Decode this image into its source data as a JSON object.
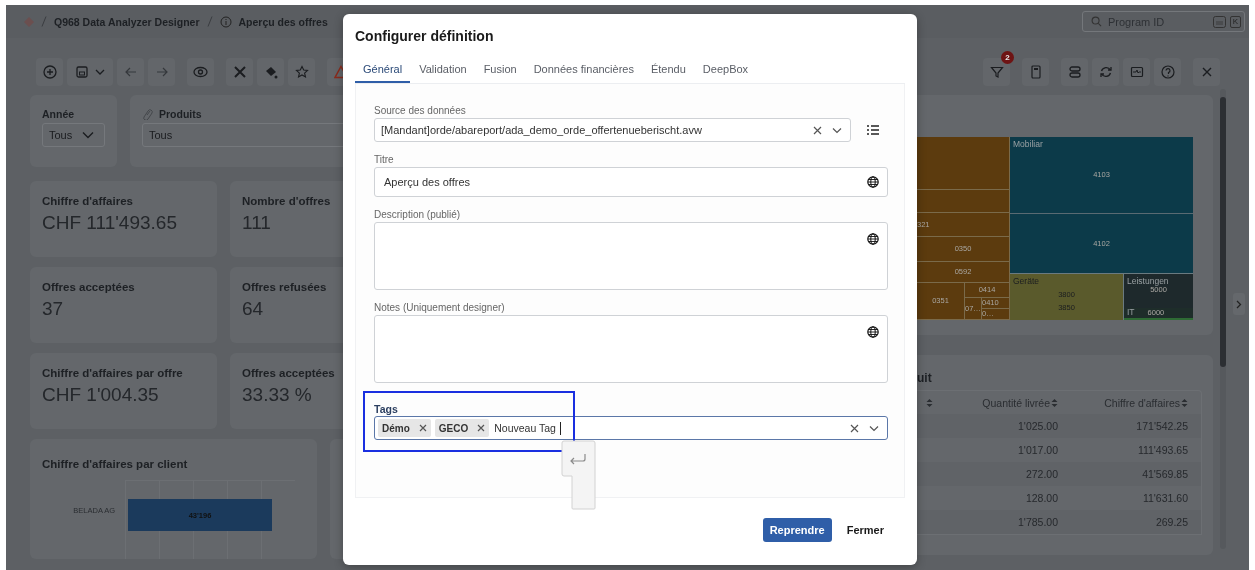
{
  "breadcrumb": [
    {
      "label": "Q968 Data Analyzer Designer",
      "kind": "app"
    },
    {
      "label": "Aperçu des offres",
      "kind": "page"
    }
  ],
  "search": {
    "placeholder": "Program ID",
    "shortcut_key": "K"
  },
  "toolbar": {
    "filter_badge": "2"
  },
  "filters": [
    {
      "label": "Année",
      "value": "Tous",
      "kind": "dropdown"
    },
    {
      "label": "Produits",
      "value": "Tous",
      "kind": "linked"
    }
  ],
  "kpis": [
    {
      "label": "Chiffre d'affaires",
      "value": "CHF 111'493.65"
    },
    {
      "label": "Nombre d'offres",
      "value": "111"
    },
    {
      "label": "Offres acceptées",
      "value": "37"
    },
    {
      "label": "Offres refusées",
      "value": "64"
    },
    {
      "label": "Chiffre d'affaires par offre",
      "value": "CHF 1'004.35"
    },
    {
      "label": "Offres acceptées",
      "value": "33.33 %"
    }
  ],
  "client_chart": {
    "title": "Chiffre d'affaires par client",
    "bar_label": "BELADA AG",
    "bar_value": "43'196"
  },
  "treemap": {
    "groups": [
      {
        "color": "#5c3b0e",
        "cells": [
          "321",
          "0350",
          "0592",
          "0351",
          "0414",
          "07…",
          "0410",
          "0…"
        ]
      },
      {
        "label": "Mobiliar",
        "color": "#0c3a49",
        "cells": [
          "4103",
          "4102"
        ]
      },
      {
        "label": "Geräte",
        "color": "#5a5a2c",
        "cells": [
          "3800",
          "3850"
        ]
      },
      {
        "label": "Leistungen",
        "color": "#1e292c",
        "cells": [
          "5000"
        ]
      },
      {
        "label": "IT",
        "color": "#1e2d2a",
        "cells": [
          "6000"
        ]
      }
    ]
  },
  "table": {
    "title": "uit",
    "columns": [
      {
        "label": "Quantité livrée"
      },
      {
        "label": "Chiffre d'affaires"
      }
    ],
    "rows": [
      [
        "1'025.00",
        "171'542.25"
      ],
      [
        "1'017.00",
        "111'493.65"
      ],
      [
        "272.00",
        "41'569.85"
      ],
      [
        "128.00",
        "11'631.60"
      ],
      [
        "1'785.00",
        "269.25"
      ]
    ]
  },
  "dialog": {
    "title": "Configurer définition",
    "tabs": [
      {
        "label": "Général",
        "selected": true
      },
      {
        "label": "Validation",
        "selected": false
      },
      {
        "label": "Fusion",
        "selected": false
      },
      {
        "label": "Données financières",
        "selected": false
      },
      {
        "label": "Étendu",
        "selected": false
      },
      {
        "label": "DeepBox",
        "selected": false
      }
    ],
    "fields": [
      {
        "kind": "select",
        "label": "Source des données",
        "value": "[Mandant]orde/abareport/ada_demo_orde_offertenueberischt.avw",
        "focused": false
      },
      {
        "kind": "text",
        "label": "Titre",
        "value": "Aperçu des offres",
        "focused": false
      },
      {
        "kind": "textarea",
        "label": "Description (publié)",
        "focused": false
      },
      {
        "kind": "textarea",
        "label": "Notes (Uniquement designer)",
        "focused": false
      },
      {
        "kind": "tags",
        "label": "Tags",
        "tags": [
          "Démo",
          "GECO"
        ],
        "value": "Nouveau Tag",
        "focused": true
      }
    ],
    "buttons": [
      {
        "label": "Reprendre",
        "kind": "primary"
      },
      {
        "label": "Fermer",
        "kind": "plain"
      }
    ]
  }
}
